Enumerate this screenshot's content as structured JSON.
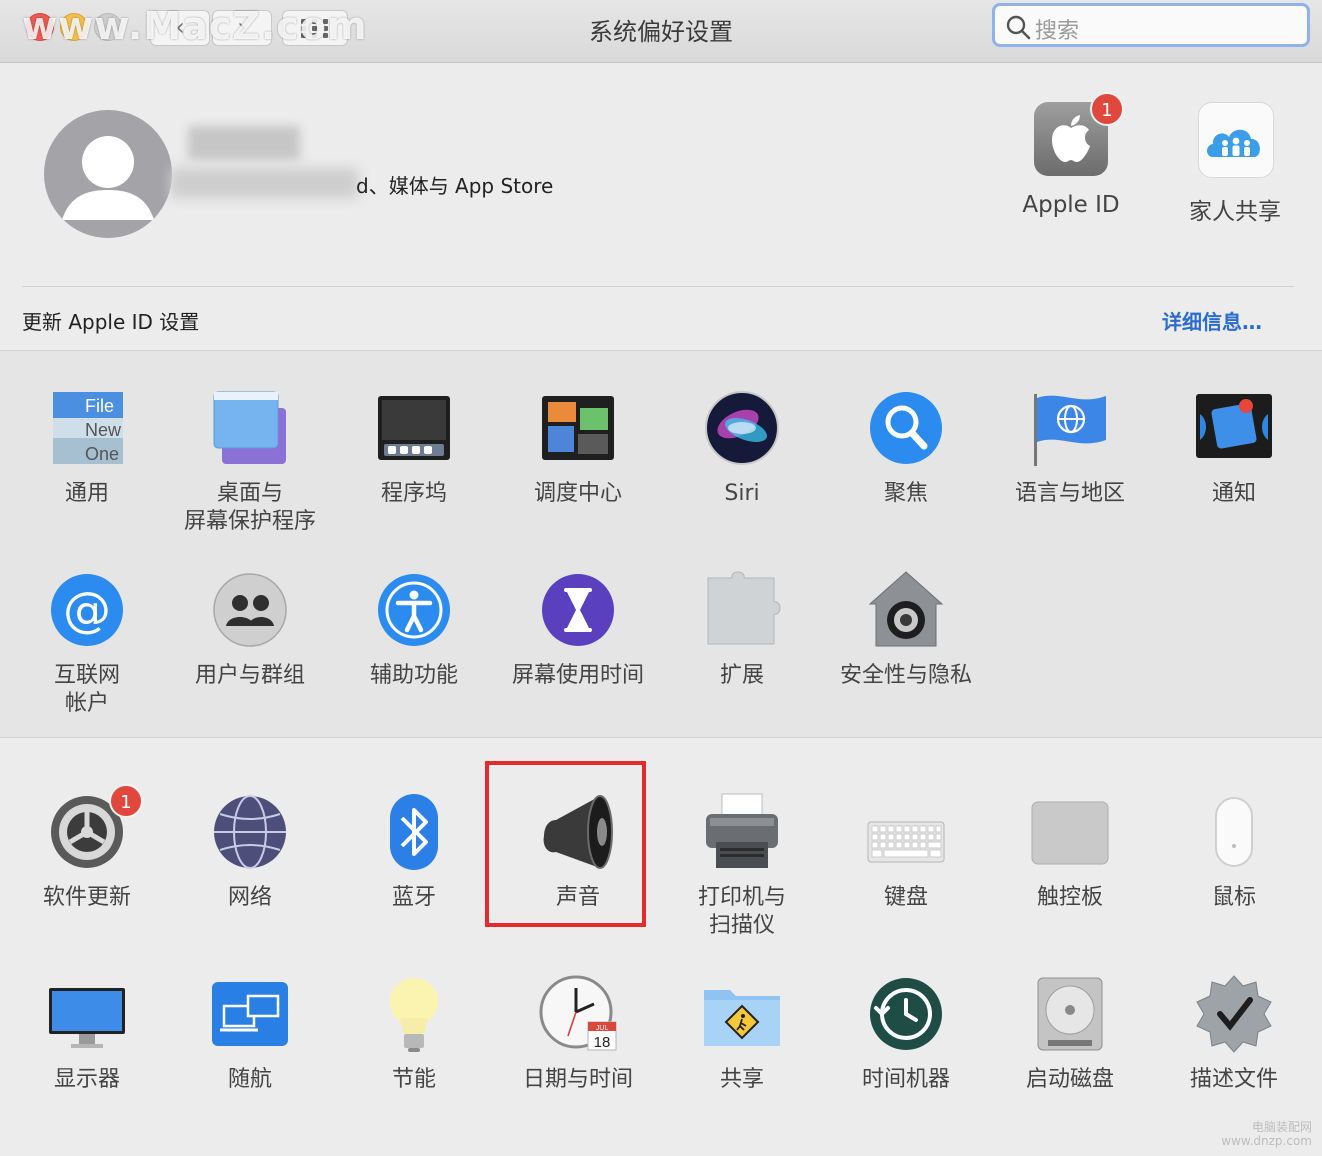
{
  "window": {
    "title": "系统偏好设置"
  },
  "watermark": "www.MacZ.com",
  "search": {
    "placeholder": "搜索"
  },
  "account": {
    "subtitle": "d、媒体与 App Store"
  },
  "top_items": [
    {
      "label": "Apple ID",
      "icon": "apple-id-icon",
      "badge": "1"
    },
    {
      "label": "家人共享",
      "icon": "family-sharing-icon"
    }
  ],
  "update_banner": {
    "text": "更新 Apple ID 设置",
    "link": "详细信息…"
  },
  "row1": [
    "通用",
    "桌面与\n屏幕保护程序",
    "程序坞",
    "调度中心",
    "Siri",
    "聚焦",
    "语言与地区",
    "通知"
  ],
  "row2": [
    "互联网\n帐户",
    "用户与群组",
    "辅助功能",
    "屏幕使用时间",
    "扩展",
    "安全性与隐私"
  ],
  "row3": [
    "软件更新",
    "网络",
    "蓝牙",
    "声音",
    "打印机与\n扫描仪",
    "键盘",
    "触控板",
    "鼠标"
  ],
  "row4": [
    "显示器",
    "随航",
    "节能",
    "日期与时间",
    "共享",
    "时间机器",
    "启动磁盘",
    "描述文件"
  ],
  "software_update_badge": "1",
  "clock_icon": {
    "month": "JUL",
    "day": "18"
  },
  "general_icon": {
    "lines": [
      "File",
      "New",
      "One"
    ]
  },
  "corner_watermark": [
    "电脑装配网",
    "www.dnzp.com"
  ]
}
